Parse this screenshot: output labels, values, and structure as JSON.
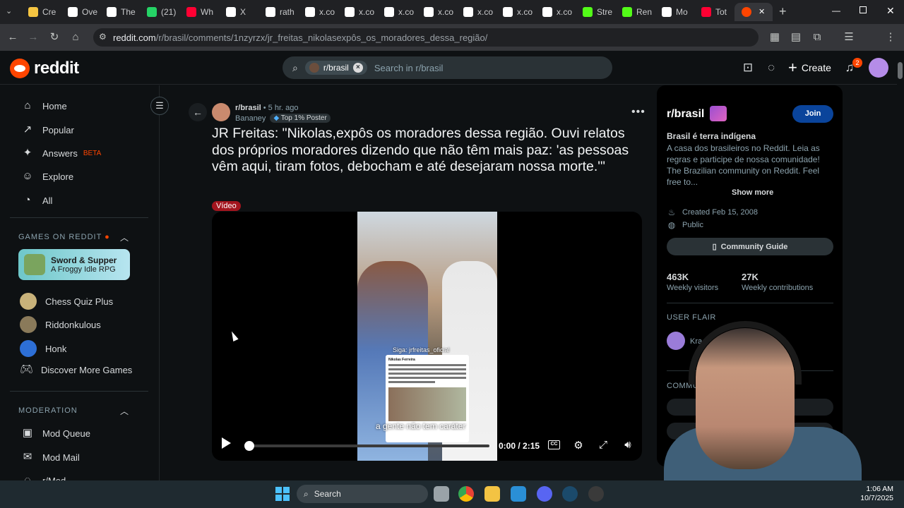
{
  "browser": {
    "tabs": [
      {
        "label": "Cre",
        "color": "#f5c542"
      },
      {
        "label": "Ove",
        "color": "#ffffff"
      },
      {
        "label": "The",
        "color": "#ffffff"
      },
      {
        "label": "(21)",
        "color": "#25d366"
      },
      {
        "label": "Wh",
        "color": "#ff0033"
      },
      {
        "label": "X",
        "color": "#ffffff"
      },
      {
        "label": "rath",
        "color": "#ffffff"
      },
      {
        "label": "x.co",
        "color": "#ffffff"
      },
      {
        "label": "x.co",
        "color": "#ffffff"
      },
      {
        "label": "x.co",
        "color": "#ffffff"
      },
      {
        "label": "x.co",
        "color": "#ffffff"
      },
      {
        "label": "x.co",
        "color": "#ffffff"
      },
      {
        "label": "x.co",
        "color": "#ffffff"
      },
      {
        "label": "x.co",
        "color": "#ffffff"
      },
      {
        "label": "Stre",
        "color": "#53fc18"
      },
      {
        "label": "Ren",
        "color": "#53fc18"
      },
      {
        "label": "Mo",
        "color": "#ffffff"
      },
      {
        "label": "Tot",
        "color": "#ff0033"
      }
    ],
    "active_tab_close": "✕",
    "new_tab": "+",
    "url_host": "reddit.com",
    "url_path": "/r/brasil/comments/1nzyrzx/jr_freitas_nikolasexpôs_os_moradores_dessa_região/"
  },
  "header": {
    "logo_text": "reddit",
    "search_chip": "r/brasil",
    "search_placeholder": "Search in r/brasil",
    "create_label": "Create",
    "notification_count": "2"
  },
  "sidebar": {
    "items": [
      {
        "label": "Home",
        "icon": "home-icon",
        "glyph": "⌂"
      },
      {
        "label": "Popular",
        "icon": "popular-icon",
        "glyph": "↗"
      },
      {
        "label": "Answers",
        "icon": "answers-icon",
        "glyph": "✦"
      },
      {
        "label": "Explore",
        "icon": "explore-icon",
        "glyph": "☺"
      },
      {
        "label": "All",
        "icon": "all-icon",
        "glyph": "◔"
      }
    ],
    "answers_badge": "BETA",
    "games_header": "GAMES ON REDDIT",
    "featured_game_title": "Sword & Supper",
    "featured_game_subtitle": "A Froggy Idle RPG",
    "games": [
      {
        "label": "Chess Quiz Plus",
        "color": "#c8b27a"
      },
      {
        "label": "Riddonkulous",
        "color": "#8a7a5a"
      },
      {
        "label": "Honk",
        "color": "#2d6fd6"
      },
      {
        "label": "Discover More Games",
        "color": ""
      }
    ],
    "moderation_header": "MODERATION",
    "mod_items": [
      {
        "label": "Mod Queue",
        "glyph": "▣"
      },
      {
        "label": "Mod Mail",
        "glyph": "✉"
      },
      {
        "label": "r/Mod",
        "glyph": "◌"
      }
    ]
  },
  "post": {
    "subreddit": "r/brasil",
    "age": "5 hr. ago",
    "author": "Bananey",
    "author_flair": "Top 1% Poster",
    "title": "JR Freitas: \"Nikolas,expôs os moradores dessa região. Ouvi relatos dos próprios moradores dizendo que não têm mais paz: 'as pessoas vêm aqui, tiram fotos, debocham e até desejaram nossa morte.'\"",
    "flair": "Vídeo",
    "video": {
      "watermark": "Siga: jrfreitas_oficial",
      "caption": "a gente não tem caráter",
      "time": "0:00 / 2:15",
      "progress": 0,
      "embedded_tweet_author": "Nikolas Ferreira"
    }
  },
  "community": {
    "name": "r/brasil",
    "join_label": "Join",
    "tagline": "Brasil é terra indígena",
    "description": "A casa dos brasileiros no Reddit. Leia as regras e participe de nossa comunidade! The Brazilian community on Reddit. Feel free to...",
    "show_more": "Show more",
    "created": "Created Feb 15, 2008",
    "visibility": "Public",
    "guide_label": "Community Guide",
    "weekly_visitors": "463K",
    "weekly_visitors_label": "Weekly visitors",
    "weekly_contributions": "27K",
    "weekly_contributions_label": "Weekly contributions",
    "user_flair_header": "USER FLAIR",
    "user_flair_name": "Kra",
    "community_header": "COMMUN"
  },
  "taskbar": {
    "search_label": "Search",
    "time": "1:06 AM",
    "date": "10/7/2025"
  },
  "colors": {
    "accent": "#ff4500",
    "join": "#0a449b",
    "video_tag": "#a3151e"
  }
}
